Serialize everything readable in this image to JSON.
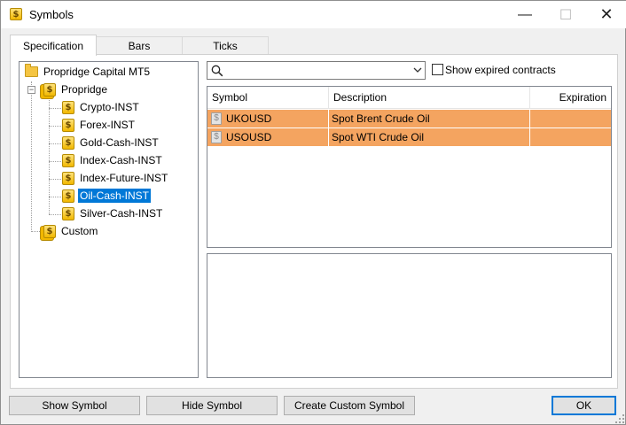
{
  "window": {
    "title": "Symbols",
    "min_glyph": "—",
    "max_glyph": "☐",
    "close_glyph": "✕"
  },
  "tabs": [
    {
      "label": "Specification",
      "active": true
    },
    {
      "label": "Bars",
      "active": false
    },
    {
      "label": "Ticks",
      "active": false
    }
  ],
  "tree": {
    "root": {
      "label": "Propridge Capital MT5",
      "icon": "folder-icon"
    },
    "group": {
      "label": "Propridge",
      "icon": "coin-stack-icon",
      "expander": "−"
    },
    "items": [
      {
        "label": "Crypto-INST"
      },
      {
        "label": "Forex-INST"
      },
      {
        "label": "Gold-Cash-INST"
      },
      {
        "label": "Index-Cash-INST"
      },
      {
        "label": "Index-Future-INST"
      },
      {
        "label": "Oil-Cash-INST",
        "selected": true
      },
      {
        "label": "Silver-Cash-INST"
      }
    ],
    "custom": {
      "label": "Custom",
      "icon": "custom-coin-icon"
    }
  },
  "search": {
    "value": "",
    "placeholder": ""
  },
  "show_expired": {
    "label": "Show expired contracts",
    "checked": false
  },
  "table": {
    "columns": [
      "Symbol",
      "Description",
      "Expiration"
    ],
    "rows": [
      {
        "symbol": "UKOUSD",
        "description": "Spot Brent Crude Oil",
        "expiration": ""
      },
      {
        "symbol": "USOUSD",
        "description": "Spot WTI Crude Oil",
        "expiration": ""
      }
    ]
  },
  "buttons": {
    "show_symbol": "Show Symbol",
    "hide_symbol": "Hide Symbol",
    "create_custom_symbol": "Create Custom Symbol",
    "ok": "OK"
  },
  "colors": {
    "selected_row": "#f4a460",
    "tree_selection": "#0078d7",
    "coin_gold": "#f2b800"
  }
}
